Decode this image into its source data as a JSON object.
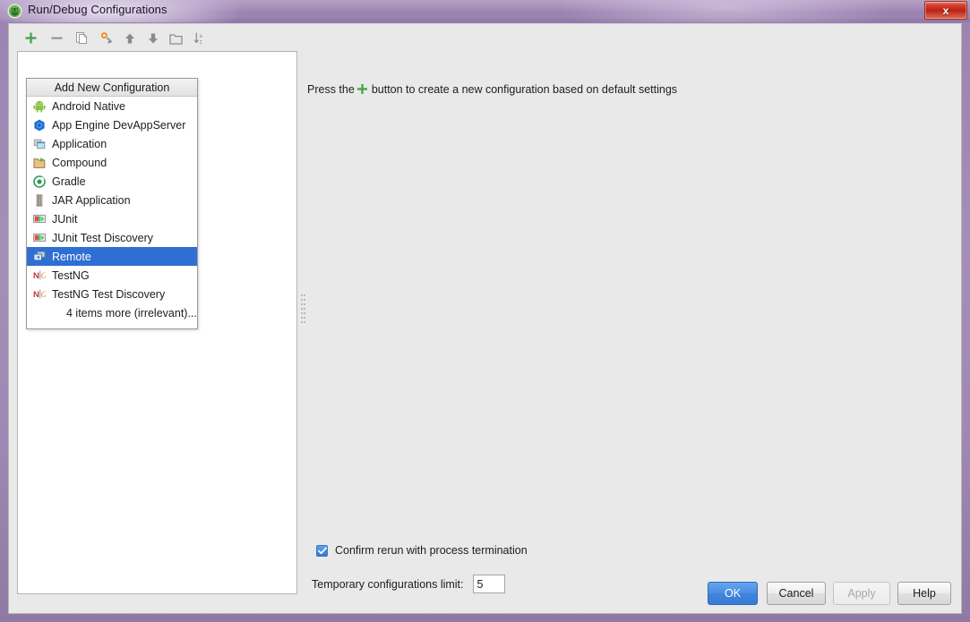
{
  "window": {
    "title": "Run/Debug Configurations",
    "app_icon": "android-studio-icon",
    "close_label": "x",
    "titlebar_color": "#9b83b0",
    "close_color": "#b92216"
  },
  "toolbar": {
    "buttons": [
      {
        "name": "add-configuration-button",
        "icon": "plus-icon",
        "label": "+"
      },
      {
        "name": "remove-configuration-button",
        "icon": "minus-icon",
        "label": "−"
      },
      {
        "name": "copy-configuration-button",
        "icon": "copy-icon",
        "label": "copy"
      },
      {
        "name": "edit-defaults-button",
        "icon": "wrench-icon",
        "label": "edit defaults"
      },
      {
        "name": "move-up-button",
        "icon": "arrow-up-icon",
        "label": "move up"
      },
      {
        "name": "move-down-button",
        "icon": "arrow-down-icon",
        "label": "move down"
      },
      {
        "name": "create-folder-button",
        "icon": "folder-icon",
        "label": "create folder"
      },
      {
        "name": "sort-configurations-button",
        "icon": "sort-az-icon",
        "label": "sort"
      }
    ]
  },
  "add_popup": {
    "header": "Add New Configuration",
    "selected_index": 8,
    "items": [
      {
        "label": "Android Native",
        "icon": "android-icon"
      },
      {
        "label": "App Engine DevAppServer",
        "icon": "app-engine-icon"
      },
      {
        "label": "Application",
        "icon": "application-icon"
      },
      {
        "label": "Compound",
        "icon": "compound-folder-icon"
      },
      {
        "label": "Gradle",
        "icon": "gradle-icon"
      },
      {
        "label": "JAR Application",
        "icon": "jar-icon"
      },
      {
        "label": "JUnit",
        "icon": "junit-icon"
      },
      {
        "label": "JUnit Test Discovery",
        "icon": "junit-icon"
      },
      {
        "label": "Remote",
        "icon": "remote-icon"
      },
      {
        "label": "TestNG",
        "icon": "testng-icon"
      },
      {
        "label": "TestNG Test Discovery",
        "icon": "testng-icon"
      },
      {
        "label": "4 items more (irrelevant)...",
        "icon": "none"
      }
    ]
  },
  "content": {
    "hint_prefix": "Press the",
    "hint_suffix": "button to create a new configuration based on default settings",
    "confirm_rerun_label": "Confirm rerun with process termination",
    "confirm_rerun_checked": true,
    "temp_limit_label": "Temporary configurations limit:",
    "temp_limit_value": "5"
  },
  "buttons": {
    "ok": "OK",
    "cancel": "Cancel",
    "apply": "Apply",
    "help": "Help",
    "apply_enabled": false
  }
}
